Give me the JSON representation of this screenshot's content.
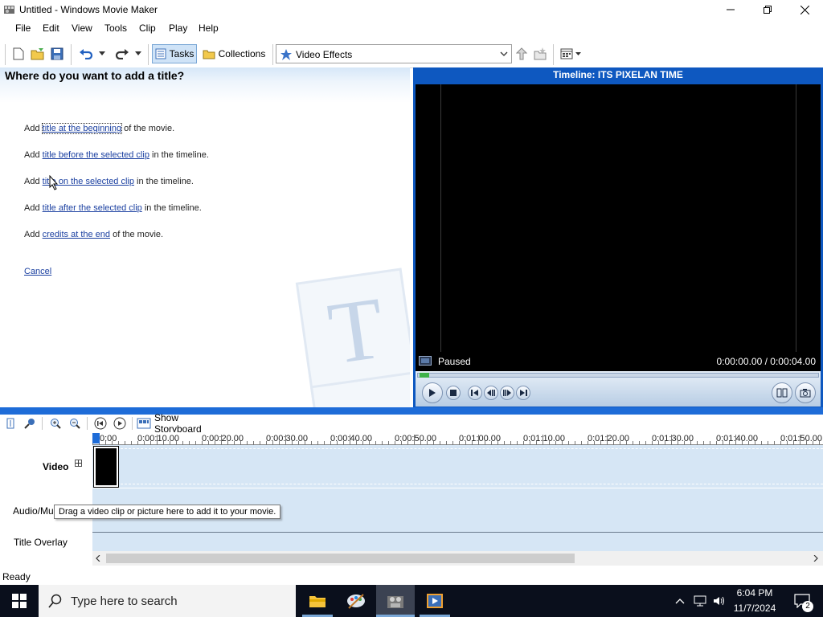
{
  "window": {
    "title": "Untitled - Windows Movie Maker"
  },
  "menu": [
    "File",
    "Edit",
    "View",
    "Tools",
    "Clip",
    "Play",
    "Help"
  ],
  "toolbar": {
    "tasks_label": "Tasks",
    "collections_label": "Collections",
    "effects_value": "Video Effects"
  },
  "task_pane": {
    "heading": "Where do you want to add a title?",
    "lines": [
      {
        "pre": "Add ",
        "link": "title at the beginning",
        "post": " of the movie."
      },
      {
        "pre": "Add ",
        "link": "title before the selected clip",
        "post": " in the timeline."
      },
      {
        "pre": "Add ",
        "link": "title on the selected clip",
        "post": " in the timeline."
      },
      {
        "pre": "Add ",
        "link": "title after the selected clip",
        "post": " in the timeline."
      },
      {
        "pre": "Add ",
        "link": "credits at the end",
        "post": " of the movie."
      }
    ],
    "cancel": "Cancel"
  },
  "preview": {
    "title": "Timeline: ITS PIXELAN TIME",
    "status": "Paused",
    "time": "0:00:00.00 / 0:00:04.00"
  },
  "timeline": {
    "show_storyboard": "Show Storyboard",
    "ticks": [
      "0:00",
      "0:00:10.00",
      "0:00:20.00",
      "0:00:30.00",
      "0:00:40.00",
      "0:00:50.00",
      "0:01:00.00",
      "0:01:10.00",
      "0:01:20.00",
      "0:01:30.00",
      "0:01:40.00",
      "0:01:50.00"
    ],
    "tracks": {
      "video": "Video",
      "audio": "Audio/Mu",
      "title_overlay": "Title Overlay"
    },
    "tooltip": "Drag a video clip or picture here to add it to your movie."
  },
  "status_bar": {
    "text": "Ready"
  },
  "taskbar": {
    "search_placeholder": "Type here to search",
    "time": "6:04 PM",
    "date": "11/7/2024",
    "notification_count": "2"
  },
  "colors": {
    "accent": "#1e6cd8",
    "link": "#1a3fa0",
    "track": "#d6e6f5"
  }
}
